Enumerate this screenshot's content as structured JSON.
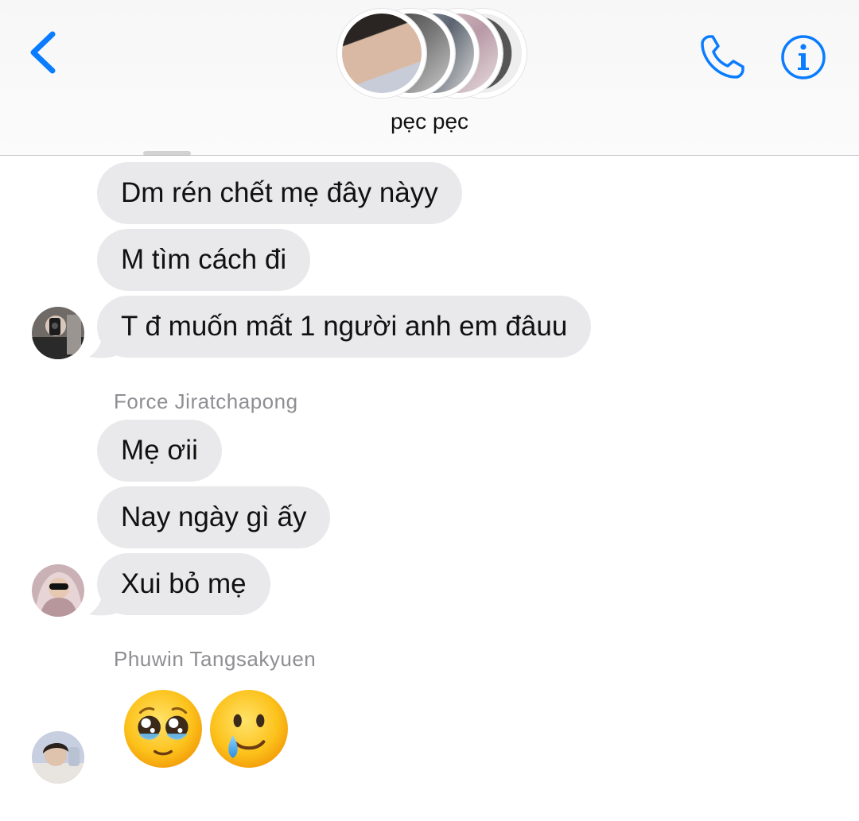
{
  "header": {
    "title": "pẹc pẹc",
    "accent_color": "#0a7cff",
    "back_icon": "chevron-left-icon",
    "call_icon": "phone-icon",
    "info_icon": "info-icon"
  },
  "messages": {
    "group1": {
      "items": [
        "Dm rén chết mẹ đây nàyy",
        "M tìm cách đi",
        "T đ muốn mất 1 người anh em đâuu"
      ]
    },
    "group2": {
      "sender": "Force Jiratchapong",
      "items": [
        "Mẹ ơii",
        "Nay ngày gì ấy",
        "Xui bỏ mẹ"
      ]
    },
    "group3": {
      "sender": "Phuwin Tangsakyuen",
      "emojis": [
        "pleading-face-with-tears",
        "smiling-face-with-tear"
      ]
    }
  },
  "colors": {
    "bubble": "#e9e9eb",
    "sender_label": "#8e8e93"
  }
}
